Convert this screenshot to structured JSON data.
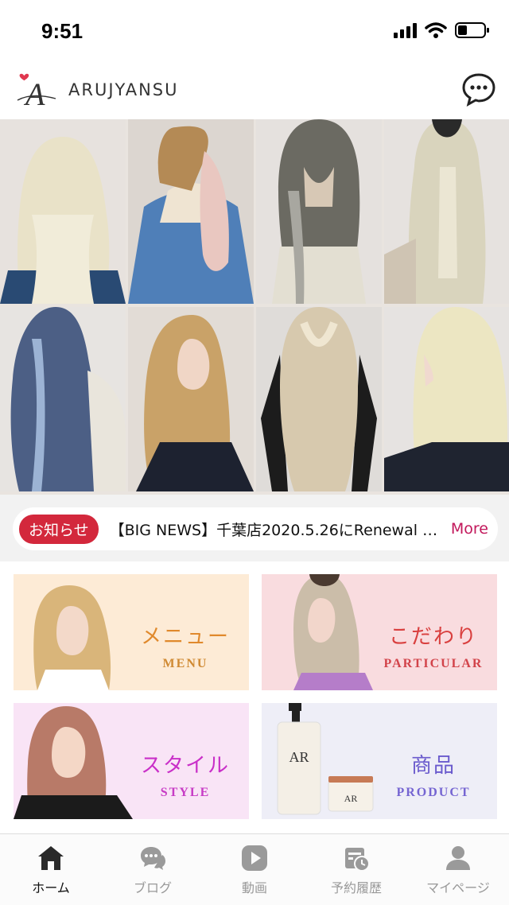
{
  "status": {
    "time": "9:51"
  },
  "header": {
    "brand": "ARUJYANSU",
    "logo_letter": "A"
  },
  "hero": {
    "slide_count": 6,
    "active_index": 2
  },
  "news": {
    "badge": "お知らせ",
    "headline": "【BIG NEWS】千葉店2020.5.26にRenewal O…",
    "more": "More"
  },
  "cards": [
    {
      "ja": "メニュー",
      "en": "MENU",
      "ja_color": "#e0892c",
      "en_color": "#d08a33",
      "bg": "#fdebd6"
    },
    {
      "ja": "こだわり",
      "en": "PARTICULAR",
      "ja_color": "#d9403f",
      "en_color": "#d2434a",
      "bg": "#f9dcdf"
    },
    {
      "ja": "スタイル",
      "en": "STYLE",
      "ja_color": "#c92fc8",
      "en_color": "#c73bc5",
      "bg": "#f9e4f6"
    },
    {
      "ja": "商品",
      "en": "PRODUCT",
      "ja_color": "#6a5acd",
      "en_color": "#7565d2",
      "bg": "#eeeef7"
    }
  ],
  "product_label": "AR",
  "tabs": [
    {
      "label": "ホーム",
      "icon": "home-icon"
    },
    {
      "label": "ブログ",
      "icon": "chat-bubbles-icon"
    },
    {
      "label": "動画",
      "icon": "play-icon"
    },
    {
      "label": "予約履歴",
      "icon": "calendar-clock-icon"
    },
    {
      "label": "マイページ",
      "icon": "user-icon"
    }
  ],
  "colors": {
    "accent": "#d3283c",
    "more": "#c2185b"
  }
}
